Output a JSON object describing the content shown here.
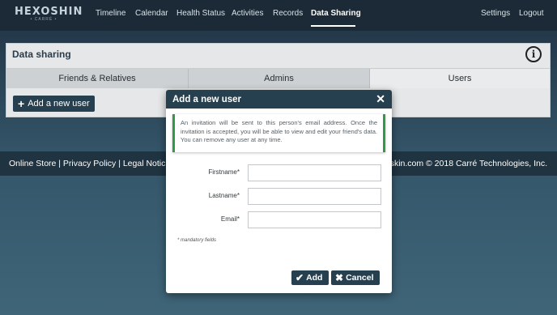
{
  "logo": {
    "brand": "HEXOSHIN",
    "sub": "• CARRÉ •"
  },
  "nav": {
    "items": [
      "Timeline",
      "Calendar",
      "Health Status",
      "Activities",
      "Records",
      "Data Sharing"
    ],
    "active": "Data Sharing",
    "settings": "Settings",
    "logout": "Logout"
  },
  "panel": {
    "title": "Data sharing",
    "tabs": [
      "Friends & Relatives",
      "Admins",
      "Users"
    ],
    "selected_tab": "Users",
    "add_button": "Add a new user"
  },
  "footer": {
    "left": "Online Store | Privacy Policy | Legal Notic",
    "right": "skin.com © 2018 Carré Technologies, Inc."
  },
  "modal": {
    "title": "Add a new user",
    "notice": "An invitation will be sent to this person's email address. Once the invitation is accepted, you will be able to view and edit your friend's data. You can remove any user at any time.",
    "fields": {
      "firstname_label": "Firstname*",
      "firstname_value": "",
      "lastname_label": "Lastname*",
      "lastname_value": "",
      "email_label": "Email*",
      "email_value": ""
    },
    "mandatory_note": "* mandatory fields",
    "add_button": "Add",
    "cancel_button": "Cancel"
  },
  "colors": {
    "accent": "#27404f",
    "notice_border": "#2f9b45",
    "nav_background": "#1b2a36"
  }
}
